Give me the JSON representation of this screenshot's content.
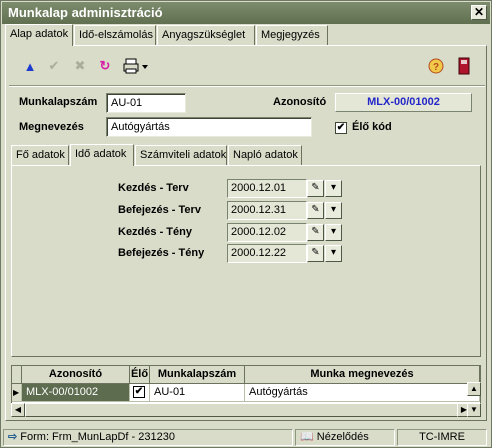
{
  "window": {
    "title": "Munkalap adminisztráció",
    "close_label": "✕"
  },
  "tabs_top": [
    "Alap adatok",
    "Idő-elszámolás",
    "Anyagszükséglet",
    "Megjegyzés"
  ],
  "form": {
    "munkalapszam_label": "Munkalapszám",
    "munkalapszam_value": "AU-01",
    "azonosito_label": "Azonosító",
    "azonosito_value": "MLX-00/01002",
    "megnevezes_label": "Megnevezés",
    "megnevezes_value": "Autógyártás",
    "elo_kod_label": "Élő kód",
    "elo_kod_checked": true
  },
  "tabs_inner": [
    "Fő adatok",
    "Idő adatok",
    "Számviteli adatok",
    "Napló adatok"
  ],
  "dates": [
    {
      "label": "Kezdés - Terv",
      "value": "2000.12.01"
    },
    {
      "label": "Befejezés - Terv",
      "value": "2000.12.31"
    },
    {
      "label": "Kezdés - Tény",
      "value": "2000.12.02"
    },
    {
      "label": "Befejezés - Tény",
      "value": "2000.12.22"
    }
  ],
  "grid": {
    "headers": [
      "Azonosító",
      "Élő",
      "Munkalapszám",
      "Munka megnevezés"
    ],
    "row": {
      "azonosito": "MLX-00/01002",
      "elo": "✔",
      "munkalapszam": "AU-01",
      "megnevezes": "Autógyártás"
    }
  },
  "status": {
    "form": "Form: Frm_MunLapDf - 231230",
    "mode": "Nézelődés",
    "user": "TC-IMRE"
  },
  "icons": {
    "up": "up-arrow-icon",
    "check": "check-icon",
    "cancel": "cancel-icon",
    "refresh": "refresh-icon",
    "print": "printer-icon",
    "help": "help-icon",
    "exit": "exit-icon"
  },
  "colors": {
    "title_bar": "#5f6f50",
    "id_text": "#2326c9",
    "selected_cell": "#5d6b4e"
  }
}
